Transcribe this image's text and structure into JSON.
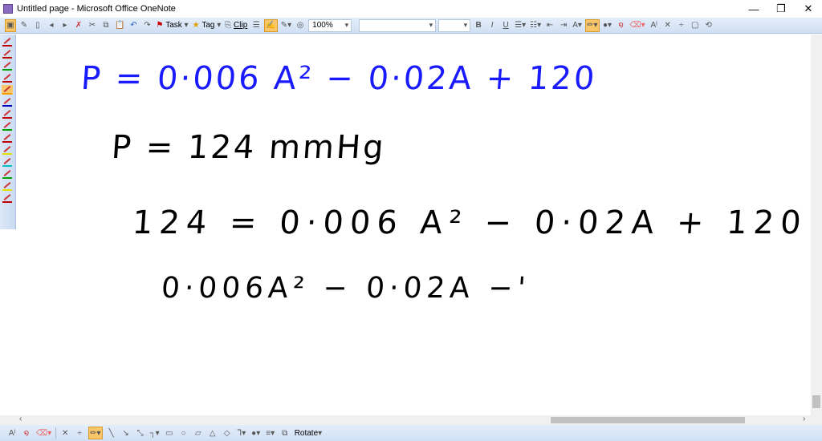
{
  "window": {
    "title": "Untitled page - Microsoft Office OneNote",
    "controls": [
      "—",
      "❐",
      "✕"
    ]
  },
  "toolbar": {
    "task_label": "Task",
    "tag_label": "Tag",
    "clip_label": "Clip",
    "zoom_value": "100%",
    "font_value": "",
    "size_value": ""
  },
  "pens": {
    "colors": [
      "#c00000",
      "#c00000",
      "#00a000",
      "#c00000",
      "#f0a000",
      "#0000c0",
      "#c00000",
      "#00a000",
      "#c00000",
      "#e0e000",
      "#00c0c0",
      "#00a000",
      "#e0e000",
      "#c00000"
    ]
  },
  "notes": {
    "line1": "P = 0·006 A² − 0·02A + 120",
    "line2": "P = 124 mmHg",
    "line3": "124 = 0·006 A² − 0·02A + 120",
    "line4": "0·006A² − 0·02A −'",
    "colors": {
      "blue": "#1a1aff",
      "black": "#000000"
    }
  },
  "drawbar": {
    "rotate_label": "Rotate"
  }
}
